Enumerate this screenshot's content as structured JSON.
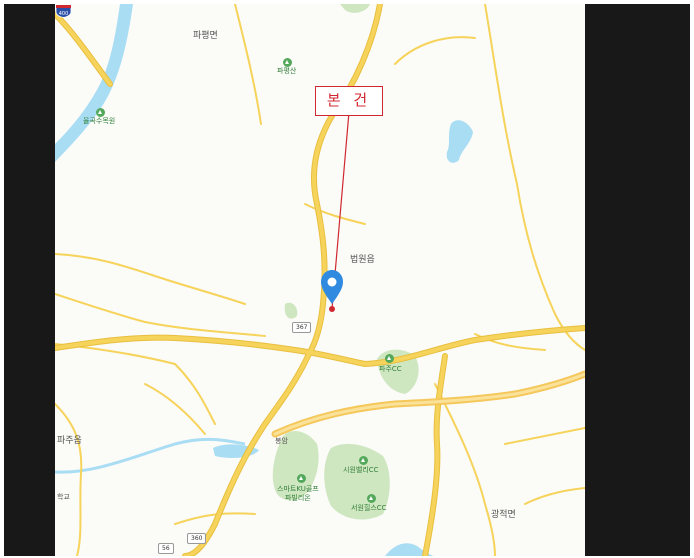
{
  "map": {
    "callout": "본 건",
    "places": {
      "papyeong_myeon": "파평면",
      "beobwon_eup": "법원읍",
      "paju_eup": "파주읍",
      "gwangjeok_myeon": "광적면",
      "bongam": "봉암"
    },
    "pois": {
      "papyeongsan": "파평산",
      "guksu_golf": "율곡수목원",
      "paju_cc": "파주CC",
      "sihwa_cc": "시원밸리CC",
      "smart_kubon": "스마트KU골프\n파빌리온",
      "seowon_cc": "서원힐스CC"
    },
    "roads": {
      "r367": "367",
      "r56": "56",
      "r360": "360",
      "expressway": "400"
    },
    "school": "학교",
    "colors": {
      "road": "#f6d35a",
      "road_edge": "#e8bf3f",
      "water": "#a9ddf3",
      "park": "#cfe7c0",
      "callout": "#d02830",
      "pin": "#2f8ae0"
    }
  }
}
